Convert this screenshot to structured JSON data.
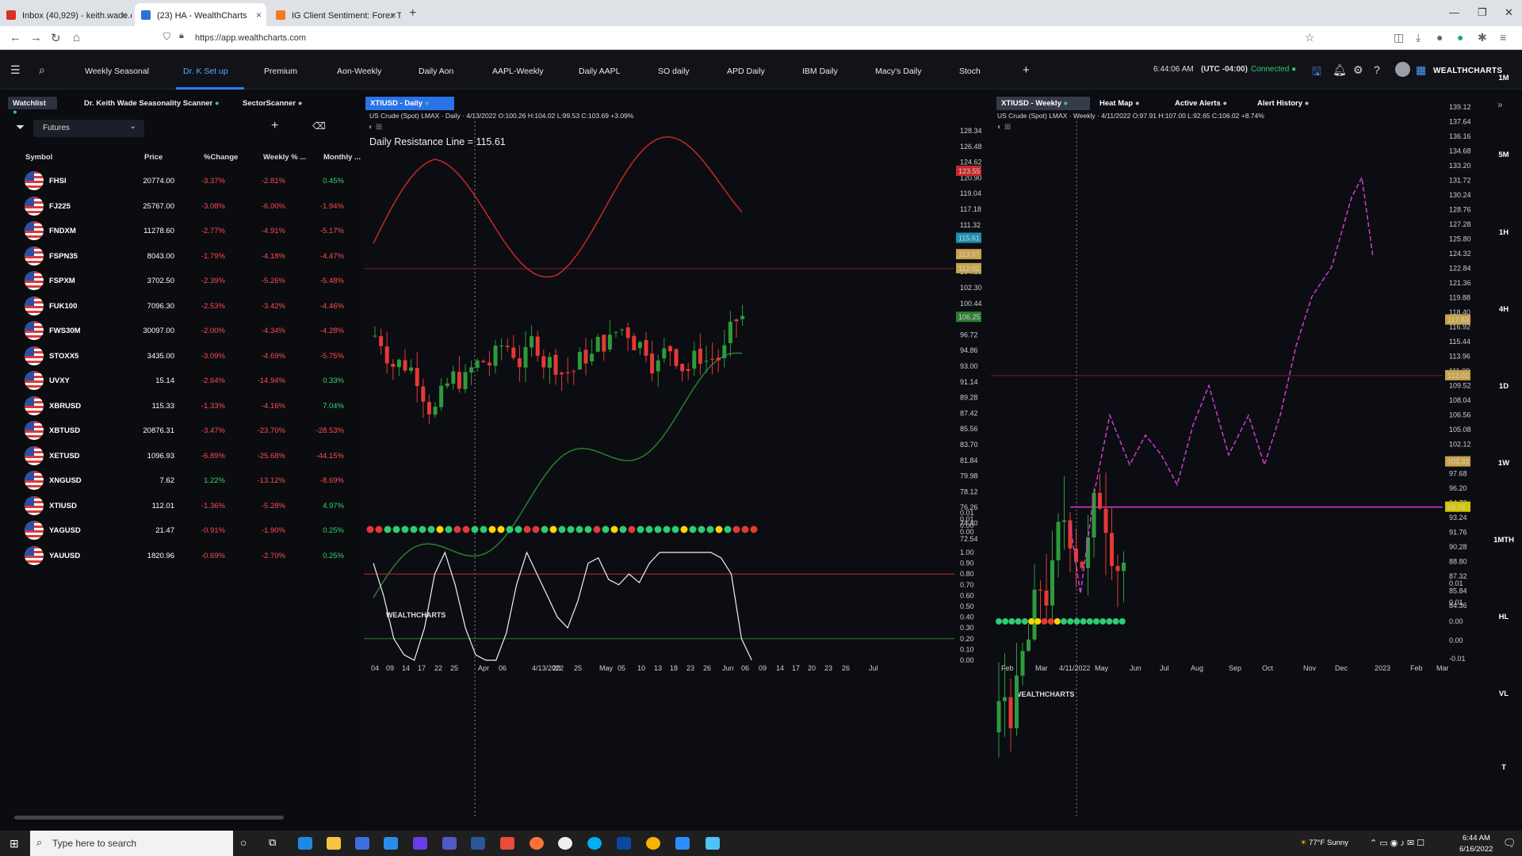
{
  "browser": {
    "tabs": [
      {
        "label": "Inbox (40,929) - keith.wade.dbz",
        "color": "#d93025"
      },
      {
        "label": "(23) HA - WealthCharts",
        "color": "#2f6fd6"
      },
      {
        "label": "IG Client Sentiment: Forex Trad",
        "color": "#f47a20"
      }
    ],
    "url": "https://app.wealthcharts.com"
  },
  "nav": {
    "tabs": [
      "Weekly Seasonal",
      "Dr. K Set up",
      "Premium",
      "Aon-Weekly",
      "Daily Aon",
      "AAPL-Weekly",
      "Daily AAPL",
      "SO daily",
      "APD Daily",
      "IBM Daily",
      "Macy's Daily",
      "Stoch"
    ],
    "add": "+",
    "time": "6:44:06 AM",
    "timezone": "(UTC -04:00)",
    "status": "Connected",
    "brand": "WEALTHCHARTS"
  },
  "left": {
    "tabs": [
      "Watchlist",
      "Dr. Keith Wade Seasonality Scanner",
      "SectorScanner"
    ],
    "filter": "Futures",
    "headers": [
      "Symbol",
      "Price",
      "%Change",
      "Weekly % ...",
      "Monthly ..."
    ],
    "rows": [
      {
        "symbol": "FHSI",
        "price": "20774.00",
        "change": "-3.37%",
        "weekly": "-2.81%",
        "monthly": "0.45%"
      },
      {
        "symbol": "FJ225",
        "price": "25767.00",
        "change": "-3.08%",
        "weekly": "-6.00%",
        "monthly": "-1.94%"
      },
      {
        "symbol": "FNDXM",
        "price": "11278.60",
        "change": "-2.77%",
        "weekly": "-4.91%",
        "monthly": "-5.17%"
      },
      {
        "symbol": "FSPN35",
        "price": "8043.00",
        "change": "-1.79%",
        "weekly": "-4.18%",
        "monthly": "-4.47%"
      },
      {
        "symbol": "FSPXM",
        "price": "3702.50",
        "change": "-2.39%",
        "weekly": "-5.26%",
        "monthly": "-5.48%"
      },
      {
        "symbol": "FUK100",
        "price": "7096.30",
        "change": "-2.53%",
        "weekly": "-3.42%",
        "monthly": "-4.46%"
      },
      {
        "symbol": "FWS30M",
        "price": "30097.00",
        "change": "-2.00%",
        "weekly": "-4.34%",
        "monthly": "-4.28%"
      },
      {
        "symbol": "STOXX5",
        "price": "3435.00",
        "change": "-3.09%",
        "weekly": "-4.69%",
        "monthly": "-5.75%"
      },
      {
        "symbol": "UVXY",
        "price": "15.14",
        "change": "-2.64%",
        "weekly": "-14.94%",
        "monthly": "0.33%"
      },
      {
        "symbol": "XBRUSD",
        "price": "115.33",
        "change": "-1.33%",
        "weekly": "-4.16%",
        "monthly": "7.04%"
      },
      {
        "symbol": "XBTUSD",
        "price": "20876.31",
        "change": "-3.47%",
        "weekly": "-23.70%",
        "monthly": "-28.53%"
      },
      {
        "symbol": "XETUSD",
        "price": "1096.93",
        "change": "-6.89%",
        "weekly": "-25.68%",
        "monthly": "-44.15%"
      },
      {
        "symbol": "XNGUSD",
        "price": "7.62",
        "change": "1.22%",
        "weekly": "-13.12%",
        "monthly": "-8.69%"
      },
      {
        "symbol": "XTIUSD",
        "price": "112.01",
        "change": "-1.36%",
        "weekly": "-5.28%",
        "monthly": "4.97%"
      },
      {
        "symbol": "YAGUSD",
        "price": "21.47",
        "change": "-0.91%",
        "weekly": "-1.90%",
        "monthly": "0.25%"
      },
      {
        "symbol": "YAUUSD",
        "price": "1820.96",
        "change": "-0.69%",
        "weekly": "-2.70%",
        "monthly": "0.25%"
      }
    ]
  },
  "daily": {
    "tab": "XTIUSD - Daily",
    "info": "US Crude (Spot) LMAX · Daily · 4/13/2022 O:100.26 H:104.02 L:99.53 C:103.69 +3.09%",
    "annotation": "Daily Resistance Line = 115.61",
    "logo": "WEALTHCHARTS",
    "price_axis": [
      "128.34",
      "126.48",
      "124.62",
      "120.90",
      "119.04",
      "117.18",
      "111.32",
      "109.74",
      "107.88",
      "104.16",
      "102.30",
      "100.44",
      "98.58",
      "96.72",
      "94.86",
      "93.00",
      "91.14",
      "89.28",
      "87.42",
      "85.56",
      "83.70",
      "81.84",
      "79.98",
      "78.12",
      "76.26",
      "74.40",
      "72.54"
    ],
    "tags": [
      {
        "v": "123.55",
        "c": "#c62828"
      },
      {
        "v": "115.61",
        "c": "#1b8fb0"
      },
      {
        "v": "113.67",
        "c": "#c8a24a"
      },
      {
        "v": "112.01",
        "c": "#c8a24a"
      },
      {
        "v": "106.25",
        "c": "#2e7d32"
      }
    ],
    "date_axis": [
      "04",
      "09",
      "14",
      "17",
      "22",
      "25",
      "Apr",
      "06",
      "4/13/2022",
      "20",
      "25",
      "May",
      "05",
      "10",
      "13",
      "18",
      "23",
      "26",
      "Jun",
      "06",
      "09",
      "14",
      "17",
      "20",
      "23",
      "26",
      "Jul"
    ],
    "dot_axis": [
      "0.01",
      "0.01",
      "0.00",
      "0.00"
    ],
    "osc_axis": [
      "1.00",
      "0.90",
      "0.80",
      "0.70",
      "0.60",
      "0.50",
      "0.40",
      "0.30",
      "0.20",
      "0.10",
      "0.00"
    ]
  },
  "weekly": {
    "tabs": [
      "XTIUSD - Weekly",
      "Heat Map",
      "Active Alerts",
      "Alert History"
    ],
    "info": "US Crude (Spot) LMAX · Weekly · 4/11/2022 O:97.91 H:107.00 L:92.65 C:106.02 +8.74%",
    "logo": "WEALTHCHARTS",
    "price_axis": [
      "139.12",
      "137.64",
      "136.16",
      "134.68",
      "133.20",
      "131.72",
      "130.24",
      "128.76",
      "127.28",
      "125.80",
      "124.32",
      "122.84",
      "121.36",
      "119.88",
      "118.40",
      "116.92",
      "115.44",
      "113.96",
      "111.00",
      "109.52",
      "108.04",
      "106.56",
      "105.08",
      "102.12",
      "100.64",
      "97.68",
      "96.20",
      "94.72",
      "93.24",
      "91.76",
      "90.28",
      "88.80",
      "87.32",
      "85.84",
      "84.36"
    ],
    "tags": [
      {
        "v": "117.63",
        "c": "#c8a24a"
      },
      {
        "v": "112.01",
        "c": "#c8a24a"
      },
      {
        "v": "103.31",
        "c": "#c8a24a"
      },
      {
        "v": "98.74",
        "c": "#d4c400"
      }
    ],
    "osc_axis": [
      "0.01",
      "0.01",
      "0.00",
      "0.00",
      "-0.01"
    ],
    "date_axis": [
      "Feb",
      "Mar",
      "4/11/2022",
      "May",
      "Jun",
      "Jul",
      "Aug",
      "Sep",
      "Oct",
      "Nov",
      "Dec",
      "2023",
      "Feb",
      "Mar"
    ]
  },
  "timeframes": [
    "1M",
    "5M",
    "1H",
    "4H",
    "1D",
    "1W",
    "1MTH",
    "HL",
    "VL",
    "T"
  ],
  "taskbar": {
    "search": "Type here to search",
    "weather": "77°F Sunny",
    "time": "6:44 AM",
    "date": "6/16/2022"
  }
}
